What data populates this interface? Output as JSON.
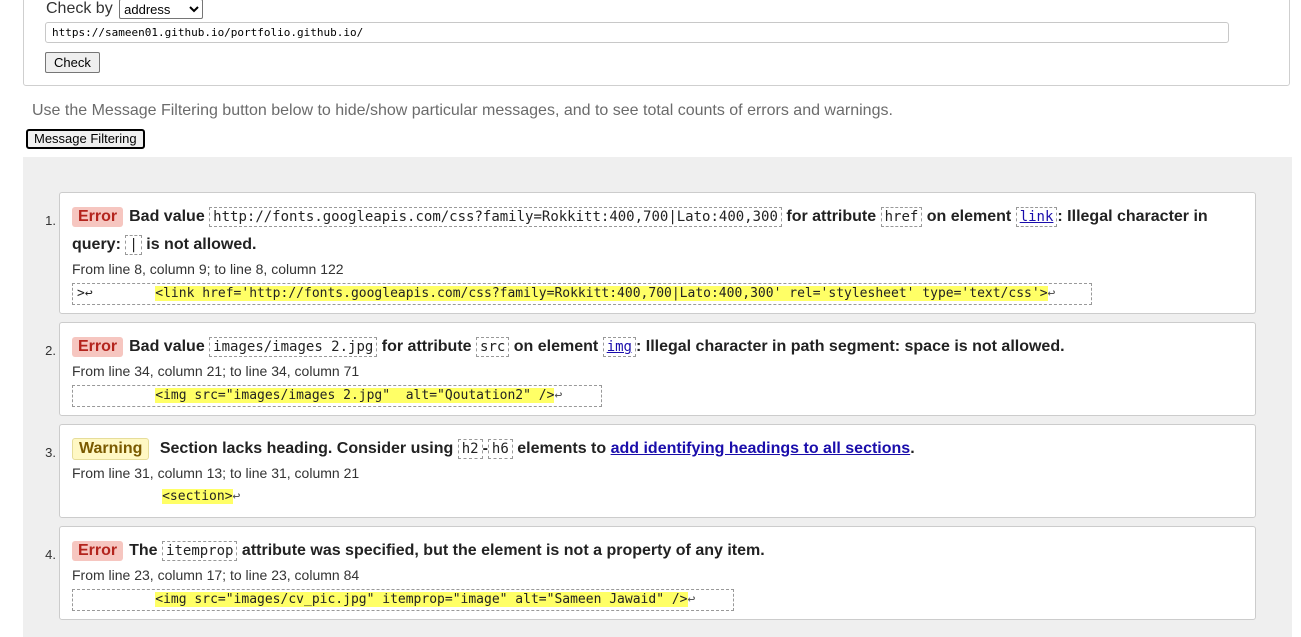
{
  "form": {
    "checkby_label": "Check by",
    "checkby_value": "address",
    "url_value": "https://sameen01.github.io/portfolio.github.io/",
    "check_label": "Check"
  },
  "filter": {
    "hint": "Use the Message Filtering button below to hide/show particular messages, and to see total counts of errors and warnings.",
    "button_label": "Message Filtering"
  },
  "messages": [
    {
      "num": "1.",
      "type": "Error",
      "parts": [
        "Bad value",
        "http://fonts.googleapis.com/css?family=Rokkitt:400,700|Lato:400,300",
        "for attribute",
        "href",
        "on element",
        "link",
        ": Illegal character in query:",
        "|",
        "is not allowed."
      ],
      "location": "From line 8, column 9; to line 8, column 122",
      "extract_prefix": ">↩",
      "extract_code": "<link href='http://fonts.googleapis.com/css?family=Rokkitt:400,700|Lato:400,300' rel='stylesheet' type='text/css'>",
      "extract_suffix": "↩"
    },
    {
      "num": "2.",
      "type": "Error",
      "parts": [
        "Bad value",
        "images/images 2.jpg",
        "for attribute",
        "src",
        "on element",
        "img",
        ": Illegal character in path segment: space is not allowed."
      ],
      "location": "From line 34, column 21; to line 34, column 71",
      "extract_code": "<img src=\"images/images 2.jpg\"  alt=\"Qoutation2\" />",
      "extract_suffix": "↩"
    },
    {
      "num": "3.",
      "type": "Warning",
      "parts": [
        "Section lacks heading. Consider using",
        "h2",
        "-",
        "h6",
        "elements to",
        "add identifying headings to all sections",
        "."
      ],
      "location": "From line 31, column 13; to line 31, column 21",
      "extract_code": "<section>",
      "extract_suffix": "↩"
    },
    {
      "num": "4.",
      "type": "Error",
      "parts": [
        "The",
        "itemprop",
        "attribute was specified, but the element is not a property of any item."
      ],
      "location": "From line 23, column 17; to line 23, column 84",
      "extract_code": "<img src=\"images/cv_pic.jpg\" itemprop=\"image\" alt=\"Sameen Jawaid\" />",
      "extract_suffix": "↩"
    }
  ]
}
